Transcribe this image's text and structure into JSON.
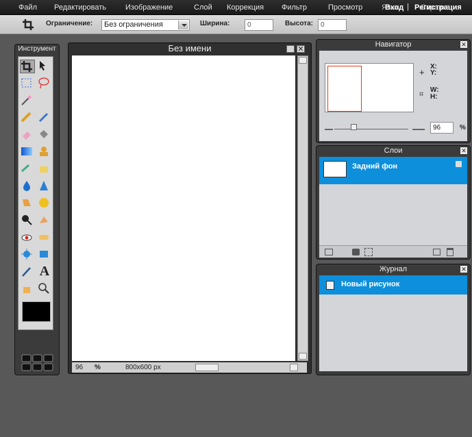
{
  "menu": {
    "items": [
      "Файл",
      "Редактировать",
      "Изображение",
      "Слой",
      "Коррекция",
      "Фильтр",
      "Просмотр",
      "Язык",
      "Справка"
    ],
    "login": "Вход",
    "separator": "|",
    "register": "Регистрация"
  },
  "options": {
    "constraint_label": "Ограничение:",
    "constraint_value": "Без ограничения",
    "width_label": "Ширина:",
    "width_value": "0",
    "height_label": "Высота:",
    "height_value": "0"
  },
  "toolbox": {
    "title": "Инструмент"
  },
  "canvas_window": {
    "title": "Без имени",
    "zoom": "96",
    "percent": "%",
    "size": "800x600 px"
  },
  "navigator": {
    "title": "Навигатор",
    "x_label": "X:",
    "y_label": "Y:",
    "w_label": "W:",
    "h_label": "H:",
    "zoom": "96",
    "percent": "%"
  },
  "layers": {
    "title": "Слои",
    "items": [
      {
        "label": "Задний фон"
      }
    ]
  },
  "history": {
    "title": "Журнал",
    "items": [
      {
        "label": "Новый рисунок"
      }
    ]
  },
  "colors": {
    "accent": "#0d8fdc",
    "foreground": "#000000"
  }
}
